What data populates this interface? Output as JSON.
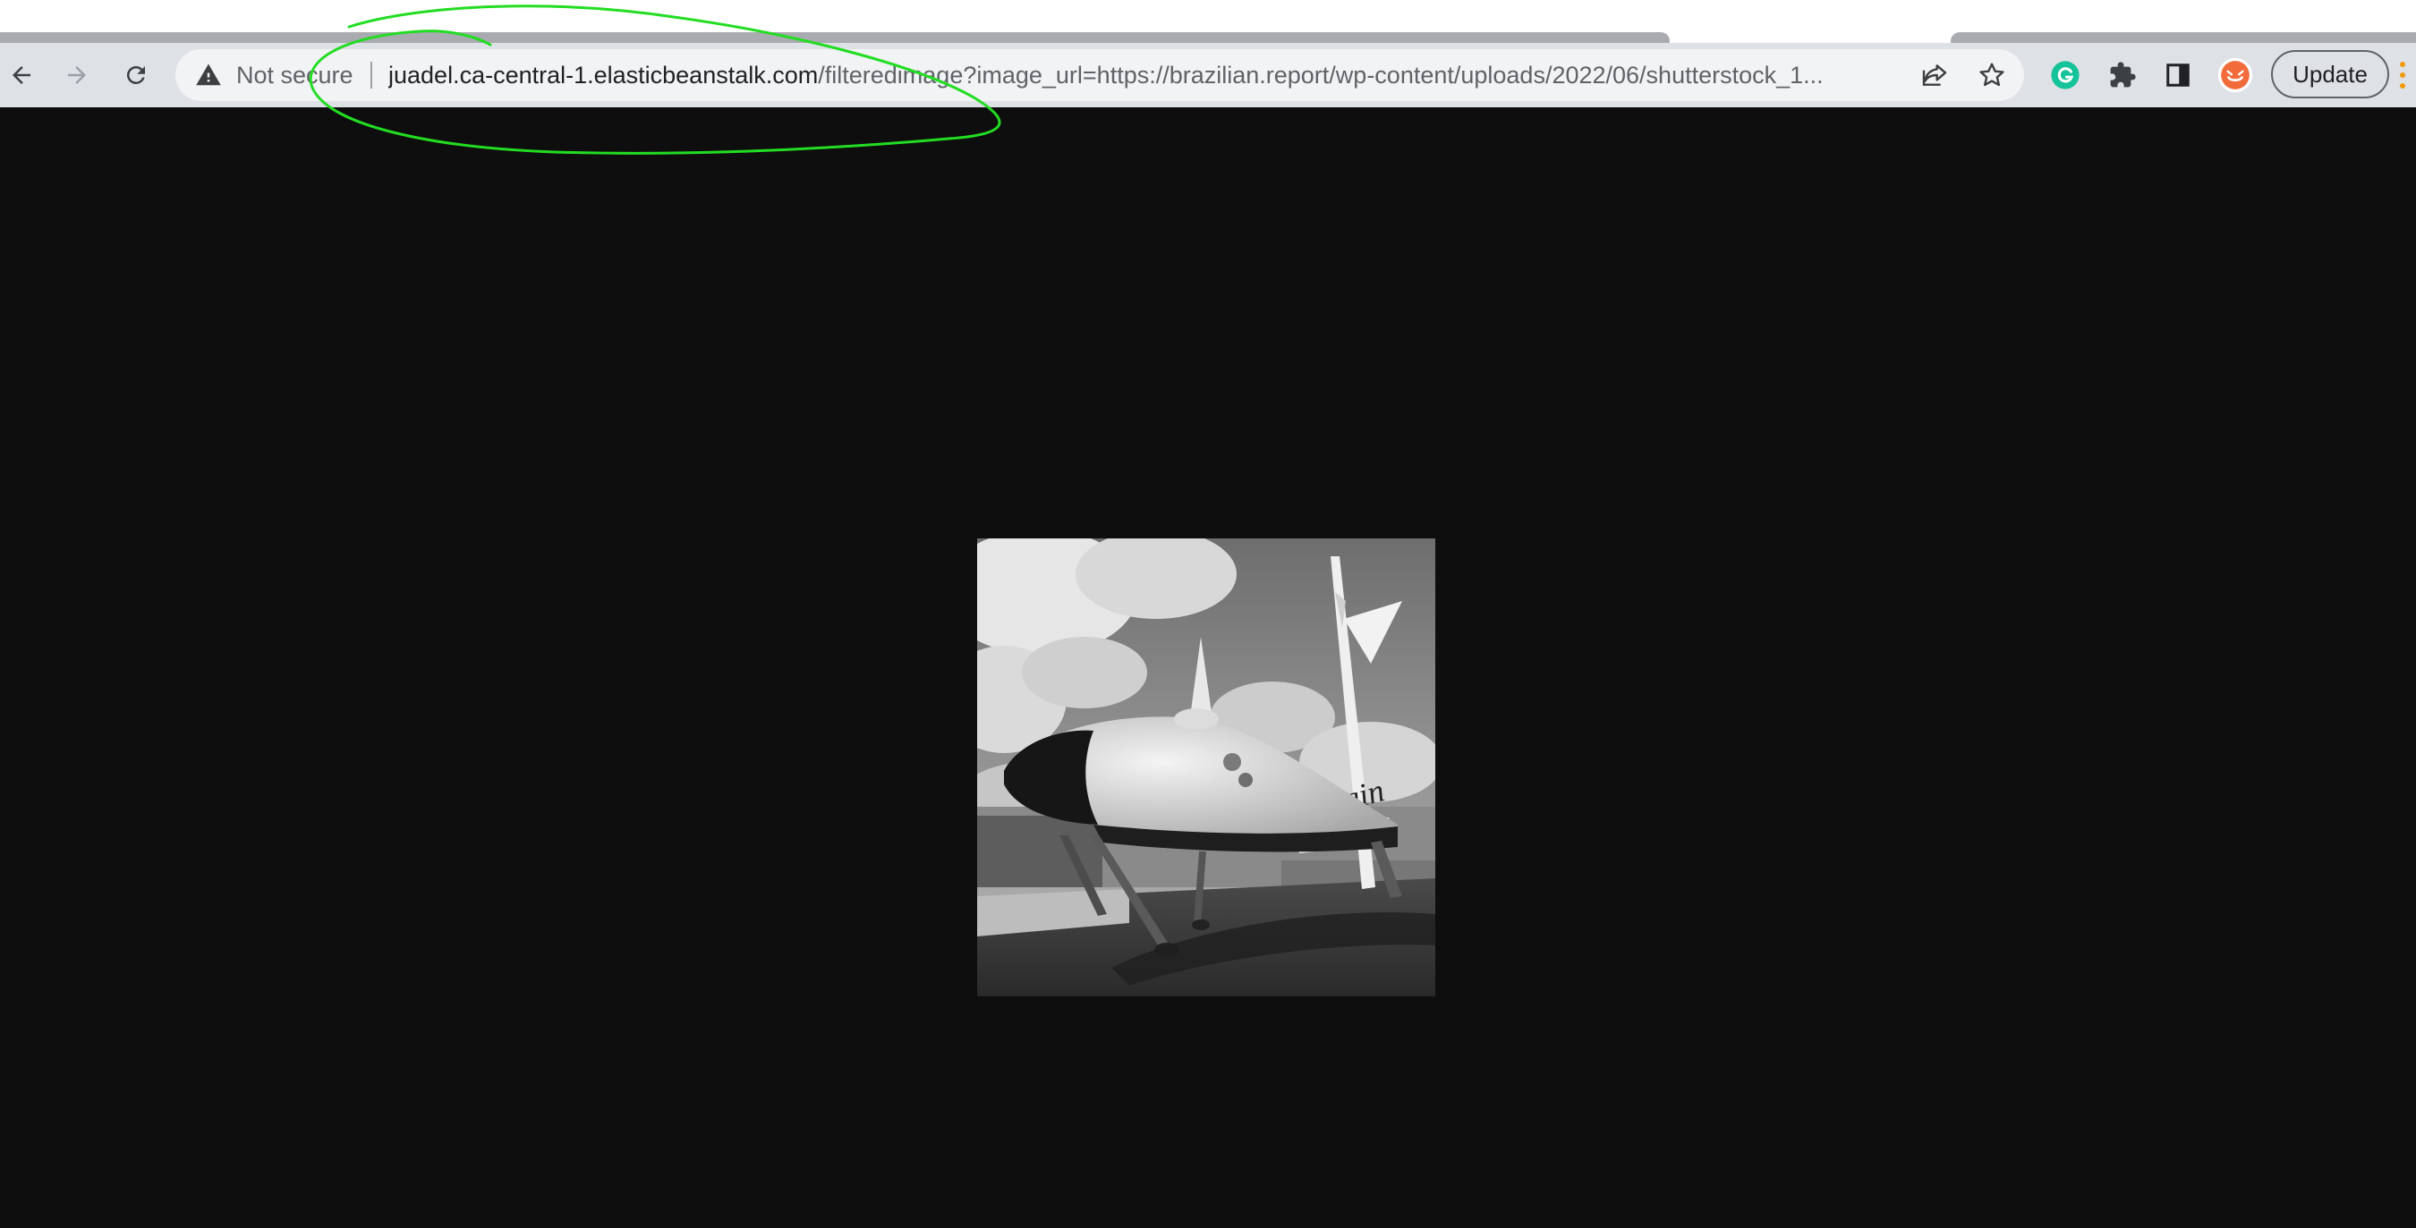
{
  "browser": {
    "security_label": "Not secure",
    "url_host": "juadel.ca-central-1.elasticbeanstalk.com",
    "url_rest": "/filteredimage?image_url=https://brazilian.report/wp-content/uploads/2022/06/shutterstock_1...",
    "update_label": "Update",
    "icons": {
      "back": "arrow-left-icon",
      "forward": "arrow-right-icon",
      "reload": "reload-icon",
      "warning": "warning-triangle-icon",
      "share": "share-icon",
      "bookmark": "star-icon",
      "grammarly": "grammarly-icon",
      "extensions": "puzzle-icon",
      "side_panel": "side-panel-icon",
      "profile": "profile-avatar-icon",
      "menu": "three-dots-icon"
    }
  },
  "colors": {
    "toolbar": "#dee1e6",
    "omnibox": "#f1f3f4",
    "page_bg": "#0e0e0e",
    "annotation": "#22dd22",
    "grammarly": "#15c39a",
    "menu_dots": "#f29900"
  },
  "content": {
    "image_subject": "grayscale photo of Virgin Galactic spaceship model",
    "image_text": "Virgin"
  }
}
